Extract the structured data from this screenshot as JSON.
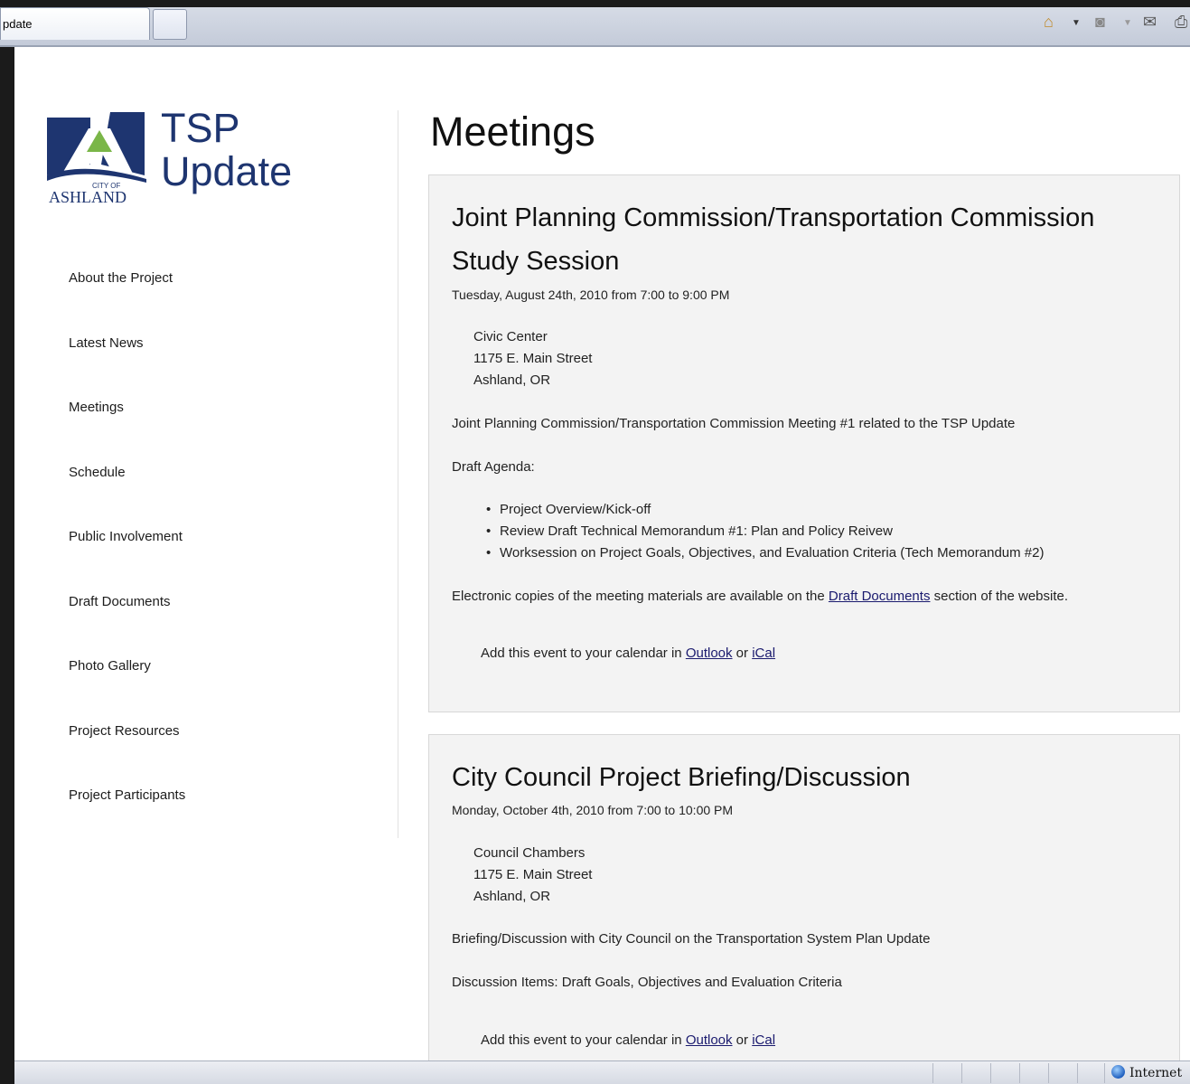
{
  "browser": {
    "tab_title": "pdate",
    "zone_label": "Internet",
    "icons": [
      "home-icon",
      "feeds-icon",
      "mail-icon",
      "print-icon"
    ]
  },
  "site": {
    "logo_city_small": "CITY OF",
    "logo_city": "ASHLAND",
    "logo_title_line1": "TSP",
    "logo_title_line2": "Update"
  },
  "nav": {
    "items": [
      "About the Project",
      "Latest News",
      "Meetings",
      "Schedule",
      "Public Involvement",
      "Draft Documents",
      "Photo Gallery",
      "Project Resources",
      "Project Participants"
    ]
  },
  "main": {
    "title": "Meetings",
    "events": [
      {
        "title": "Joint Planning Commission/Transportation Commission Study Session",
        "date": "Tuesday, August 24th, 2010 from 7:00 to 9:00 PM",
        "address": [
          "Civic Center",
          "1175 E. Main Street",
          "Ashland, OR"
        ],
        "description": "Joint Planning Commission/Transportation Commission Meeting #1 related to the TSP Update",
        "agenda_label": "Draft Agenda:",
        "agenda": [
          "Project Overview/Kick-off",
          "Review Draft Technical Memorandum #1: Plan and Policy Reivew",
          "Worksession on Project Goals, Objectives, and Evaluation Criteria (Tech Memorandum #2)"
        ],
        "materials_prefix": "Electronic copies of the meeting materials are available on the ",
        "materials_link": "Draft Documents",
        "materials_suffix": " section of the website.",
        "calendar_prefix": "Add this event to your calendar in ",
        "calendar_outlook": "Outlook",
        "calendar_or": " or ",
        "calendar_ical": "iCal"
      },
      {
        "title": "City Council Project Briefing/Discussion",
        "date": "Monday, October 4th, 2010 from 7:00 to 10:00 PM",
        "address": [
          "Council Chambers",
          "1175 E. Main Street",
          "Ashland, OR"
        ],
        "description": "Briefing/Discussion with City Council on the Transportation System Plan Update",
        "discussion": "Discussion Items: Draft Goals, Objectives and Evaluation Criteria",
        "calendar_prefix": "Add this event to your calendar in ",
        "calendar_outlook": "Outlook",
        "calendar_or": " or ",
        "calendar_ical": "iCal"
      }
    ]
  },
  "colors": {
    "logo_blue": "#1e3570",
    "logo_green": "#7ab648",
    "card_bg": "#f3f3f3",
    "link": "#1a1a6e"
  }
}
